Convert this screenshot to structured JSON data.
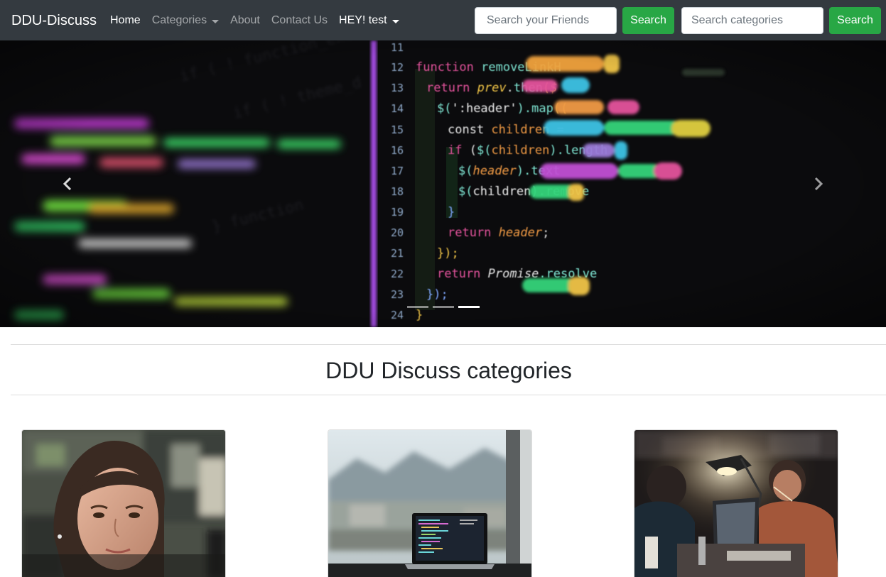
{
  "navbar": {
    "brand": "DDU-Discuss",
    "links": [
      {
        "label": "Home",
        "active": true
      },
      {
        "label": "Categories",
        "dropdown": true
      },
      {
        "label": "About"
      },
      {
        "label": "Contact Us"
      },
      {
        "label": "HEY! test",
        "dropdown": true
      }
    ],
    "friend_search": {
      "placeholder": "Search your Friends",
      "button": "Search"
    },
    "category_search": {
      "placeholder": "Search categories",
      "button": "Search"
    }
  },
  "carousel": {
    "slide_count": 3,
    "active_index": 2,
    "code_lines": [
      {
        "num": "11",
        "text": ""
      },
      {
        "num": "12",
        "text": "function removeLinkHeaders(prev) {"
      },
      {
        "num": "13",
        "text": "return prev.then($ => {"
      },
      {
        "num": "14",
        "text": "$(':header').map((i, header) => {"
      },
      {
        "num": "15",
        "text": "const children = $(header).children();"
      },
      {
        "num": "16",
        "text": "if ($(children).length > 0) {"
      },
      {
        "num": "17",
        "text": "$(header).text($(children).text());"
      },
      {
        "num": "18",
        "text": "$(children).remove();"
      },
      {
        "num": "19",
        "text": "}"
      },
      {
        "num": "20",
        "text": "return header;"
      },
      {
        "num": "21",
        "text": "});"
      },
      {
        "num": "22",
        "text": "return Promise.resolve($);"
      },
      {
        "num": "23",
        "text": "});"
      },
      {
        "num": "24",
        "text": "}"
      }
    ]
  },
  "categories": {
    "title": "DDU Discuss categories",
    "cards": [
      {
        "image": "woman-at-computer"
      },
      {
        "image": "laptop-by-window"
      },
      {
        "image": "coders-at-night"
      }
    ]
  },
  "colors": {
    "navbar_bg": "#343a40",
    "search_green": "#28a745",
    "title_text": "#212529"
  }
}
